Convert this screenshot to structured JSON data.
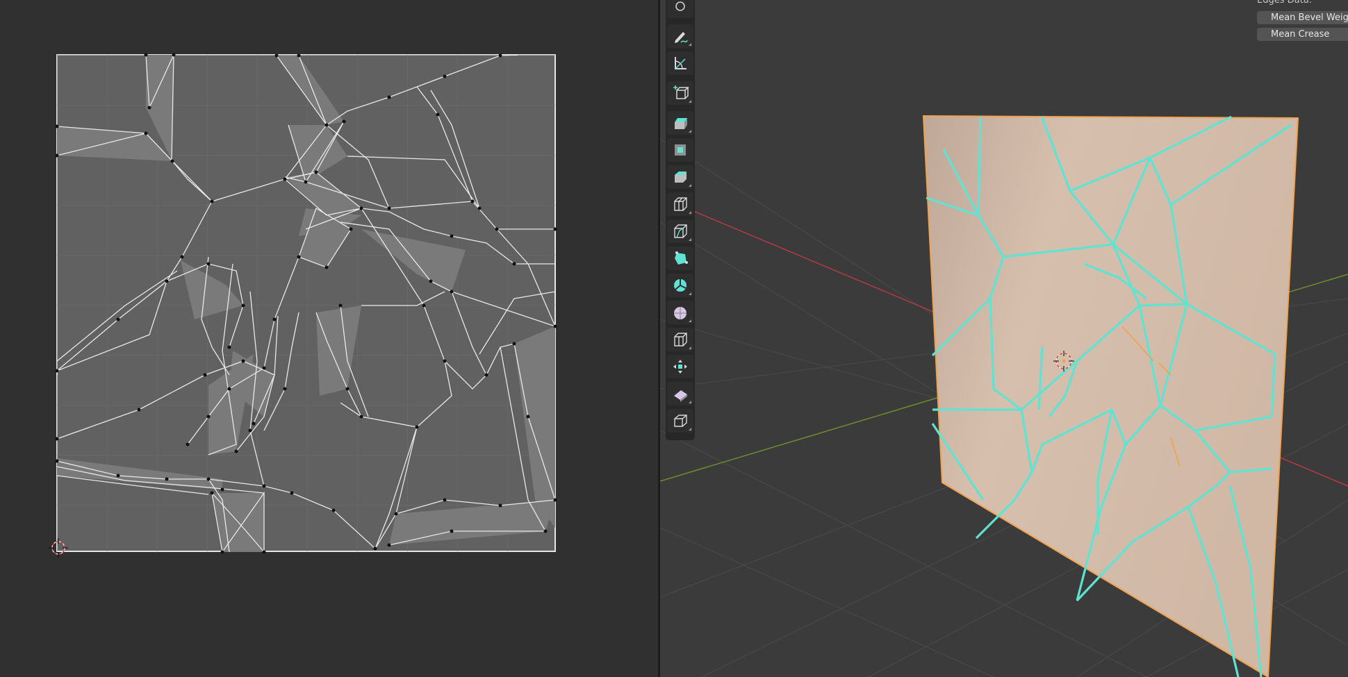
{
  "uv_editor": {
    "panel": "UV Editor"
  },
  "viewport": {
    "panel": "3D Viewport",
    "colors": {
      "background": "#3b3b3b",
      "mesh_face": "#d2b9a6",
      "selected_edges": "#5fe3d2",
      "outline": "#f0a24e",
      "x_axis": "#b53a43",
      "y_axis": "#6e8f2b"
    }
  },
  "toolbar": {
    "tools": [
      {
        "name": "annotate-icon"
      },
      {
        "name": "measure-icon"
      },
      {
        "name": "add-cube-icon"
      },
      {
        "name": "extrude-region-icon"
      },
      {
        "name": "inset-faces-icon"
      },
      {
        "name": "bevel-icon"
      },
      {
        "name": "loop-cut-icon"
      },
      {
        "name": "knife-icon"
      },
      {
        "name": "poly-build-icon"
      },
      {
        "name": "spin-icon"
      },
      {
        "name": "smooth-icon"
      },
      {
        "name": "edge-slide-icon"
      },
      {
        "name": "shrink-fatten-icon"
      },
      {
        "name": "shear-icon"
      },
      {
        "name": "rip-region-icon"
      }
    ]
  },
  "item_panel": {
    "section_title": "Edges Data:",
    "fields": [
      {
        "label": "Mean Bevel Weight"
      },
      {
        "label": "Mean Crease"
      }
    ]
  }
}
